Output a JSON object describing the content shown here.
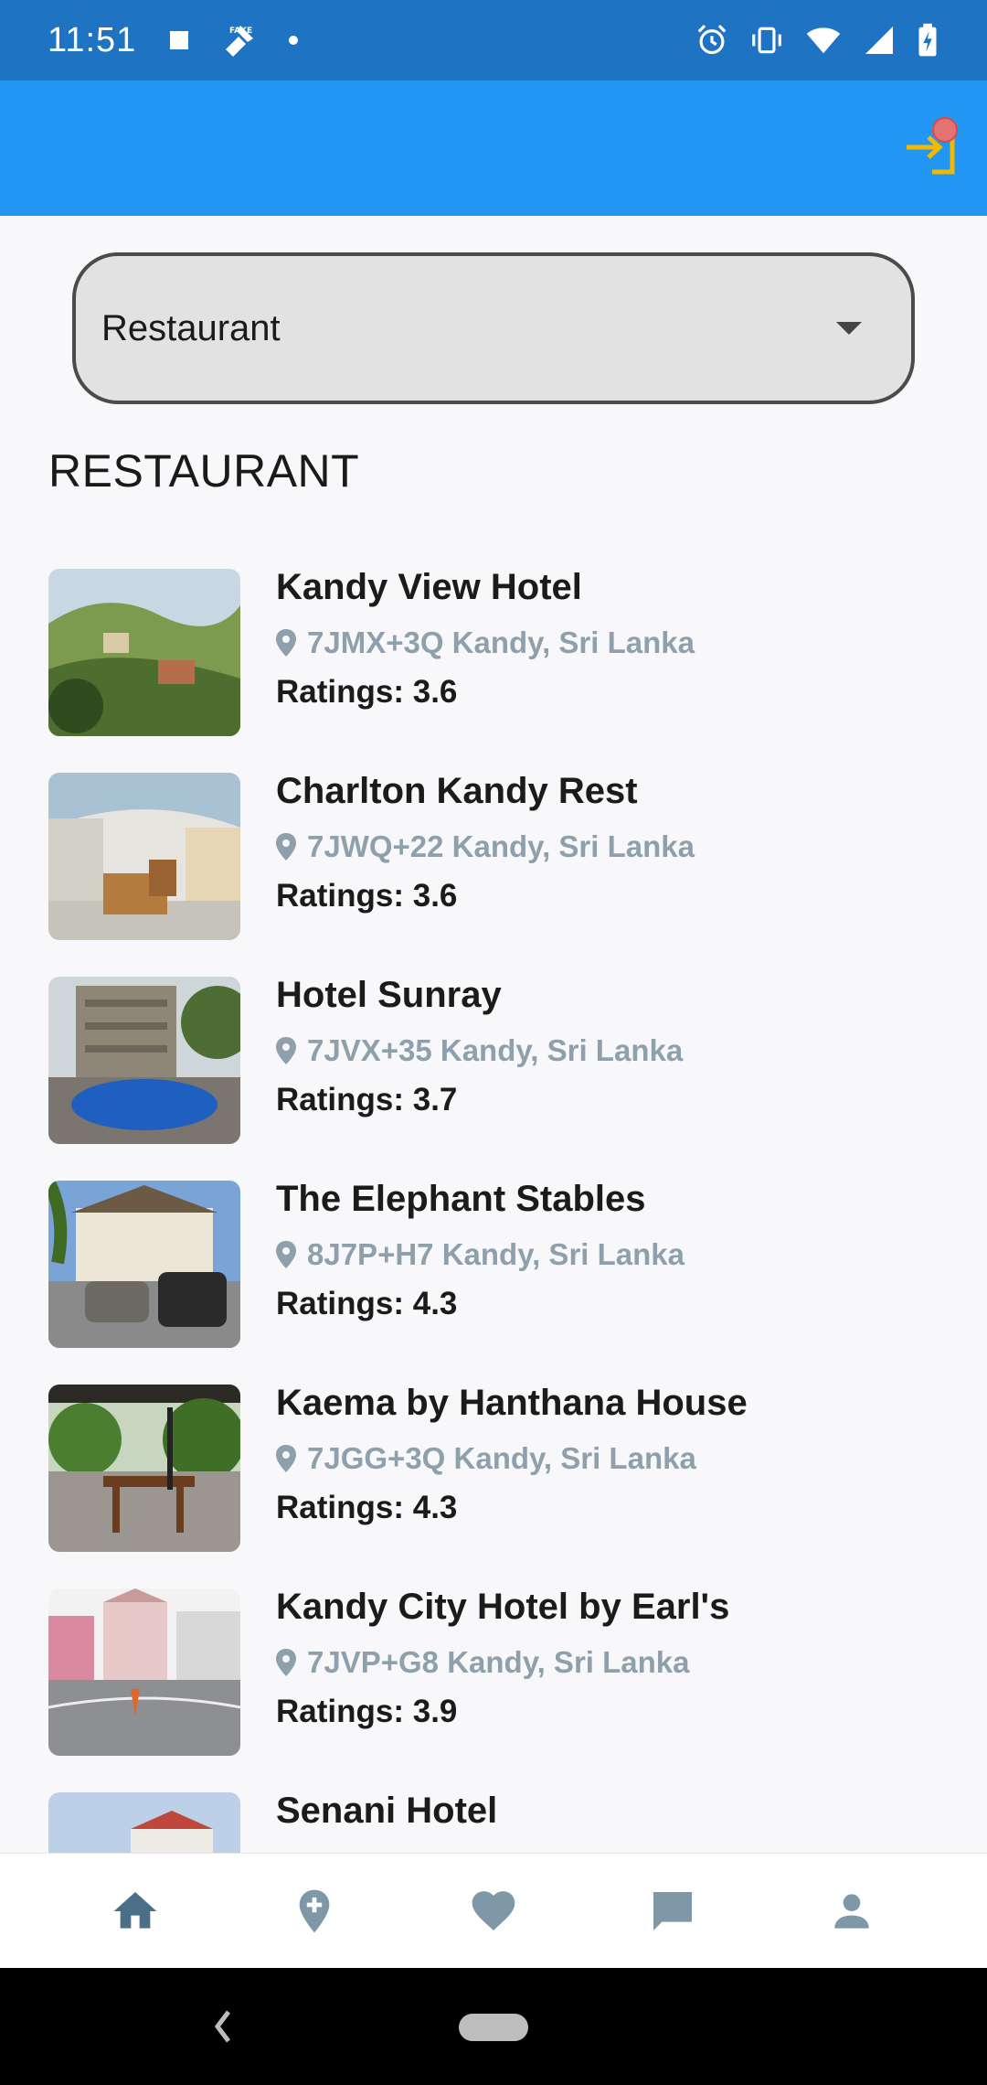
{
  "status_bar": {
    "time": "11:51"
  },
  "dropdown": {
    "value": "Restaurant"
  },
  "section": {
    "title": "RESTAURANT"
  },
  "items": [
    {
      "name": "Kandy View Hotel",
      "address": "7JMX+3Q Kandy, Sri Lanka",
      "rating": "Ratings: 3.6"
    },
    {
      "name": "Charlton Kandy Rest",
      "address": "7JWQ+22 Kandy, Sri Lanka",
      "rating": "Ratings: 3.6"
    },
    {
      "name": "Hotel Sunray",
      "address": "7JVX+35 Kandy, Sri Lanka",
      "rating": "Ratings: 3.7"
    },
    {
      "name": "The Elephant Stables",
      "address": "8J7P+H7 Kandy, Sri Lanka",
      "rating": "Ratings: 4.3"
    },
    {
      "name": "Kaema by Hanthana House",
      "address": "7JGG+3Q Kandy, Sri Lanka",
      "rating": "Ratings: 4.3"
    },
    {
      "name": "Kandy City Hotel by Earl's",
      "address": "7JVP+G8 Kandy, Sri Lanka",
      "rating": "Ratings: 3.9"
    },
    {
      "name": "Senani Hotel",
      "address": "",
      "rating": ""
    }
  ],
  "bottom_nav": {
    "items": [
      "home-icon",
      "add-location-icon",
      "heart-icon",
      "chat-icon",
      "person-icon"
    ],
    "active_color": "#4a6f86",
    "inactive_color": "#7e98a8"
  },
  "colors": {
    "status_bar": "#1e73c2",
    "app_bar": "#2196f3",
    "login_icon": "#f5b800",
    "badge": "#e57373"
  }
}
